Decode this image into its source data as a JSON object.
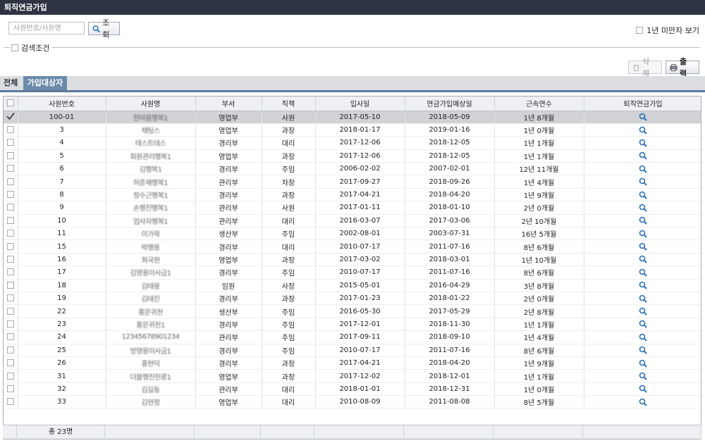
{
  "window": {
    "title": "퇴직연금가입"
  },
  "search": {
    "placeholder": "사원번호/사원명",
    "button_label": "조회"
  },
  "options": {
    "under_one_year_label": "1년 미만자 보기",
    "search_conditions_label": "검색조건"
  },
  "toolbar": {
    "delete_label": "삭 제",
    "print_label": "출 력"
  },
  "tabs": [
    {
      "label": "전체"
    },
    {
      "label": "가입대상자"
    }
  ],
  "table": {
    "columns": [
      "사원번호",
      "사원명",
      "부서",
      "직책",
      "입사일",
      "연금가입예상일",
      "근속연수",
      "퇴직연금가입"
    ],
    "rows": [
      {
        "id": "100-01",
        "name": "한마음행복1",
        "dept": "영업부",
        "position": "사원",
        "hire": "2017-05-10",
        "pension": "2018-05-09",
        "years": "1년 8개월",
        "checked": true
      },
      {
        "id": "3",
        "name": "채팅스",
        "dept": "영업부",
        "position": "과장",
        "hire": "2018-01-17",
        "pension": "2019-01-16",
        "years": "1년 0개월"
      },
      {
        "id": "4",
        "name": "테스트테스",
        "dept": "경리부",
        "position": "대리",
        "hire": "2017-12-06",
        "pension": "2018-12-05",
        "years": "1년 1개월"
      },
      {
        "id": "5",
        "name": "회원관리행복1",
        "dept": "영업부",
        "position": "과장",
        "hire": "2017-12-06",
        "pension": "2018-12-05",
        "years": "1년 1개월"
      },
      {
        "id": "6",
        "name": "김행복1",
        "dept": "경리부",
        "position": "주임",
        "hire": "2006-02-02",
        "pension": "2007-02-01",
        "years": "12년 11개월"
      },
      {
        "id": "7",
        "name": "허준재행복1",
        "dept": "관리부",
        "position": "차장",
        "hire": "2017-09-27",
        "pension": "2018-09-26",
        "years": "1년 4개월"
      },
      {
        "id": "8",
        "name": "정수근행복1",
        "dept": "경리부",
        "position": "과장",
        "hire": "2017-04-21",
        "pension": "2018-04-20",
        "years": "1년 9개월"
      },
      {
        "id": "9",
        "name": "손행진행복1",
        "dept": "관리부",
        "position": "사원",
        "hire": "2017-01-11",
        "pension": "2018-01-10",
        "years": "2년 0개월"
      },
      {
        "id": "10",
        "name": "엄사자행복1",
        "dept": "관리부",
        "position": "대리",
        "hire": "2016-03-07",
        "pension": "2017-03-06",
        "years": "2년 10개월"
      },
      {
        "id": "11",
        "name": "이가락",
        "dept": "생산부",
        "position": "주임",
        "hire": "2002-08-01",
        "pension": "2003-07-31",
        "years": "16년 5개월"
      },
      {
        "id": "15",
        "name": "박행용",
        "dept": "경리부",
        "position": "대리",
        "hire": "2010-07-17",
        "pension": "2011-07-16",
        "years": "8년 6개월"
      },
      {
        "id": "16",
        "name": "최국현",
        "dept": "영업부",
        "position": "과장",
        "hire": "2017-03-02",
        "pension": "2018-03-01",
        "years": "1년 10개월"
      },
      {
        "id": "17",
        "name": "김영용이사금1",
        "dept": "경리부",
        "position": "주임",
        "hire": "2010-07-17",
        "pension": "2011-07-16",
        "years": "8년 6개월"
      },
      {
        "id": "18",
        "name": "김태용",
        "dept": "임원",
        "position": "사장",
        "hire": "2015-05-01",
        "pension": "2016-04-29",
        "years": "3년 8개월"
      },
      {
        "id": "19",
        "name": "김태진",
        "dept": "경리부",
        "position": "과장",
        "hire": "2017-01-23",
        "pension": "2018-01-22",
        "years": "2년 0개월"
      },
      {
        "id": "22",
        "name": "홍문귀천",
        "dept": "생산부",
        "position": "주임",
        "hire": "2016-05-30",
        "pension": "2017-05-29",
        "years": "2년 8개월"
      },
      {
        "id": "23",
        "name": "홍문귀천1",
        "dept": "경리부",
        "position": "주임",
        "hire": "2017-12-01",
        "pension": "2018-11-30",
        "years": "1년 1개월"
      },
      {
        "id": "24",
        "name": "12345678901234",
        "dept": "관리부",
        "position": "주임",
        "hire": "2017-09-11",
        "pension": "2018-09-10",
        "years": "1년 4개월"
      },
      {
        "id": "25",
        "name": "방영용이사금1",
        "dept": "경리부",
        "position": "주임",
        "hire": "2010-07-17",
        "pension": "2011-07-16",
        "years": "8년 6개월"
      },
      {
        "id": "26",
        "name": "홍현덕",
        "dept": "경리부",
        "position": "과장",
        "hire": "2017-04-21",
        "pension": "2018-04-20",
        "years": "1년 9개월"
      },
      {
        "id": "31",
        "name": "더블행진헌릉1",
        "dept": "영업부",
        "position": "과장",
        "hire": "2017-12-02",
        "pension": "2018-12-01",
        "years": "1년 1개월"
      },
      {
        "id": "32",
        "name": "김길동",
        "dept": "관리부",
        "position": "대리",
        "hire": "2018-01-01",
        "pension": "2018-12-31",
        "years": "1년 0개월"
      },
      {
        "id": "33",
        "name": "김현정",
        "dept": "영업부",
        "position": "대리",
        "hire": "2010-08-09",
        "pension": "2011-08-08",
        "years": "8년 5개월"
      }
    ]
  },
  "footer": {
    "total_label": "총  23명"
  },
  "colors": {
    "titlebar": "#2f3442",
    "active_tab": "#6b8aaa",
    "selected_row": "#d0d2d6",
    "icon_blue": "#2a6fb8"
  }
}
